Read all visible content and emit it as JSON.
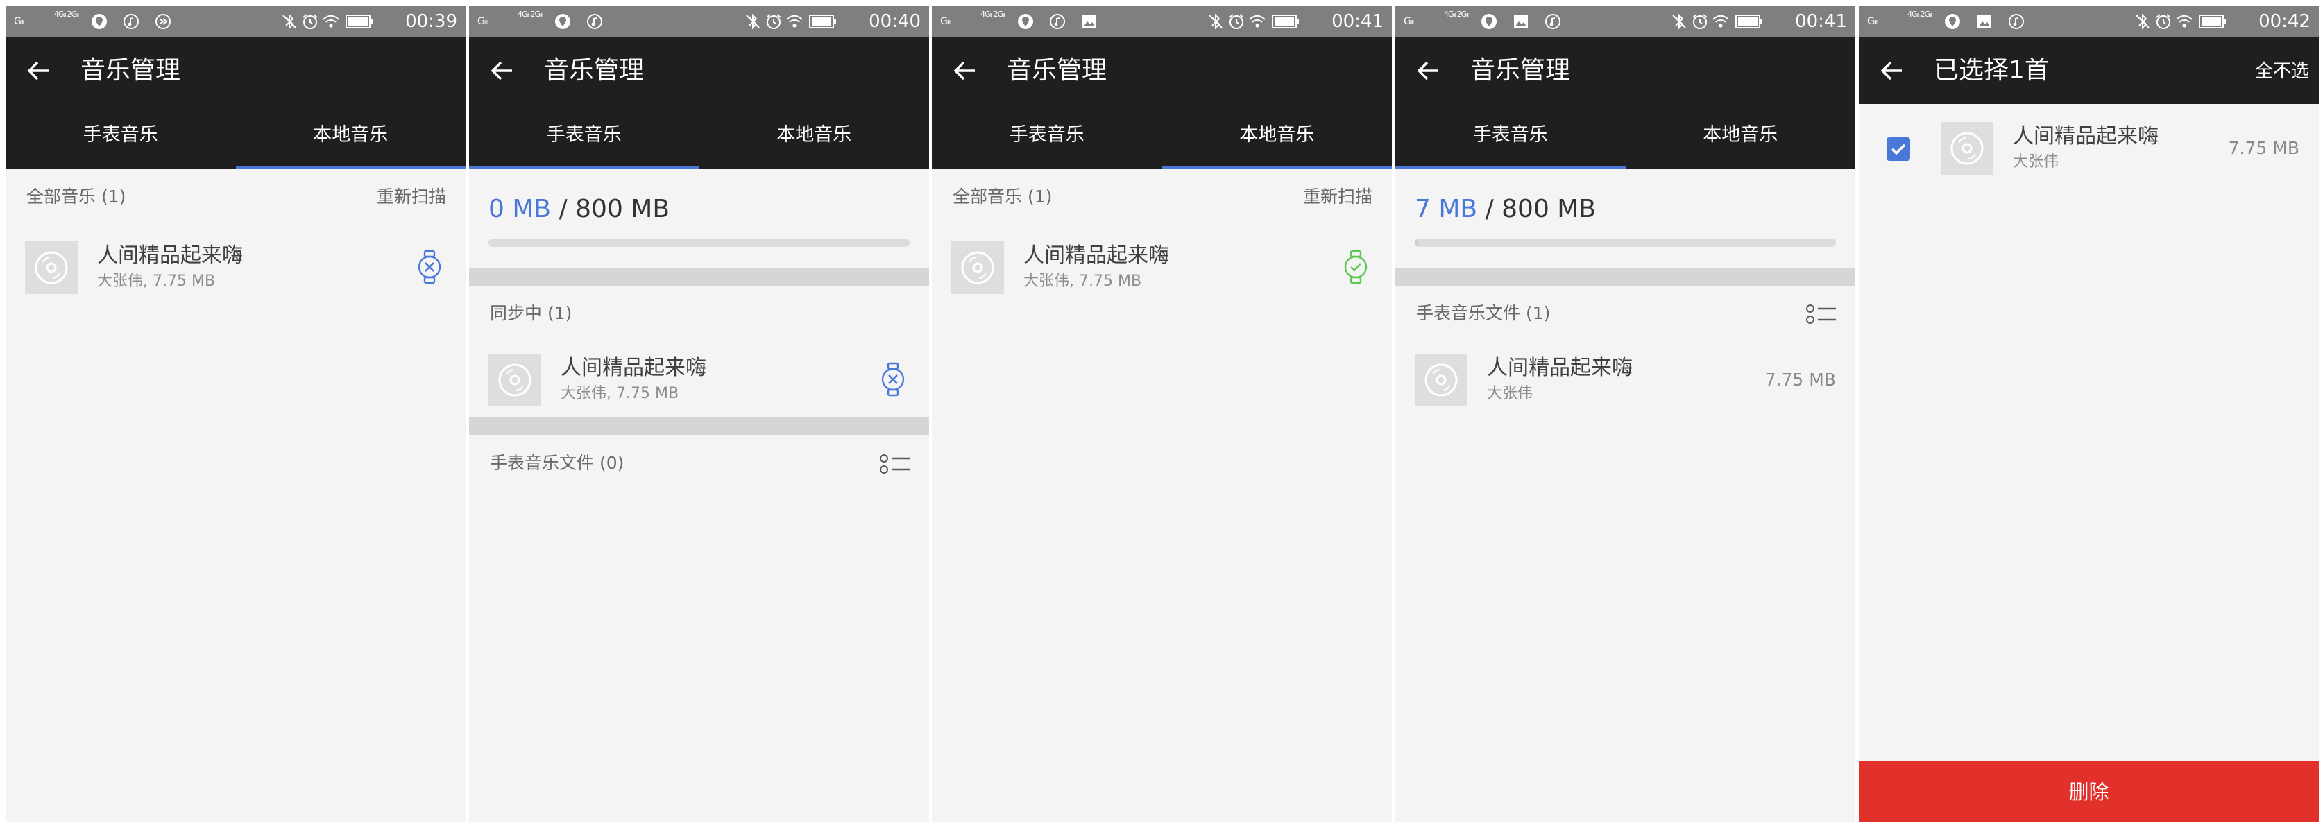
{
  "colors": {
    "status_bar": "#7f7f7f",
    "app_bar": "#1f1f1f",
    "accent_blue": "#4a78d8",
    "synced_green": "#5cc84e",
    "background": "#f4f4f4",
    "delete_red": "#e2312b"
  },
  "screens": [
    {
      "id": "s1",
      "status": {
        "signal_1": "Gᵢₗₗ",
        "signal_2": "4Gᵢₗₗ 2Gᵢₗₗ",
        "icons": [
          "location-icon",
          "music-note-icon",
          "fast-forward-icon"
        ],
        "time": "00:39"
      },
      "app_bar": {
        "title": "音乐管理",
        "mode": "back"
      },
      "tabs": [
        {
          "label": "手表音乐"
        },
        {
          "label": "本地音乐"
        }
      ],
      "active_tab": 1,
      "content": {
        "kind": "local",
        "section_title": "全部音乐 (1)",
        "section_action": "重新扫描",
        "songs": [
          {
            "title": "人间精品起来嗨",
            "subtitle": "大张伟, 7.75 MB",
            "state": "cancel-sync"
          }
        ]
      }
    },
    {
      "id": "s2",
      "status": {
        "signal_1": "Gᵢₗₗ",
        "signal_2": "4Gᵢₗₗ 2Gᵢₗₗ",
        "icons": [
          "location-icon",
          "music-note-icon"
        ],
        "time": "00:40"
      },
      "app_bar": {
        "title": "音乐管理",
        "mode": "back"
      },
      "tabs": [
        {
          "label": "手表音乐"
        },
        {
          "label": "本地音乐"
        }
      ],
      "active_tab": 0,
      "content": {
        "kind": "watch",
        "storage": {
          "used": "0 MB",
          "total": "/ 800 MB",
          "fraction": 0.0
        },
        "syncing_title": "同步中 (1)",
        "syncing_songs": [
          {
            "title": "人间精品起来嗨",
            "subtitle": "大张伟, 7.75 MB",
            "state": "cancel-sync"
          }
        ],
        "watch_title": "手表音乐文件 (0)",
        "watch_songs": []
      }
    },
    {
      "id": "s3",
      "status": {
        "signal_1": "Gᵢₗₗ",
        "signal_2": "4Gᵢₗₗ 2Gᵢₗₗ",
        "icons": [
          "location-icon",
          "music-note-icon",
          "image-icon"
        ],
        "time": "00:41"
      },
      "app_bar": {
        "title": "音乐管理",
        "mode": "back"
      },
      "tabs": [
        {
          "label": "手表音乐"
        },
        {
          "label": "本地音乐"
        }
      ],
      "active_tab": 1,
      "content": {
        "kind": "local",
        "section_title": "全部音乐 (1)",
        "section_action": "重新扫描",
        "songs": [
          {
            "title": "人间精品起来嗨",
            "subtitle": "大张伟, 7.75 MB",
            "state": "synced"
          }
        ]
      }
    },
    {
      "id": "s4",
      "status": {
        "signal_1": "Gᵢₗₗ",
        "signal_2": "4Gᵢₗₗ 2Gᵢₗₗ",
        "icons": [
          "location-icon",
          "image-icon",
          "music-note-icon"
        ],
        "time": "00:41"
      },
      "app_bar": {
        "title": "音乐管理",
        "mode": "back"
      },
      "tabs": [
        {
          "label": "手表音乐"
        },
        {
          "label": "本地音乐"
        }
      ],
      "active_tab": 0,
      "content": {
        "kind": "watch",
        "storage": {
          "used": "7 MB",
          "total": "/ 800 MB",
          "fraction": 0.00875
        },
        "syncing_title": "",
        "syncing_songs": [],
        "watch_title": "手表音乐文件 (1)",
        "watch_songs": [
          {
            "title": "人间精品起来嗨",
            "subtitle": "大张伟",
            "size": "7.75 MB"
          }
        ]
      }
    },
    {
      "id": "s5",
      "status": {
        "signal_1": "Gᵢₗₗ",
        "signal_2": "4Gᵢₗₗ 2Gᵢₗₗ",
        "icons": [
          "location-icon",
          "image-icon",
          "music-note-icon"
        ],
        "time": "00:42"
      },
      "app_bar": {
        "title": "已选择1首",
        "mode": "select",
        "action": "全不选"
      },
      "tabs": [],
      "active_tab": -1,
      "content": {
        "kind": "select",
        "songs": [
          {
            "title": "人间精品起来嗨",
            "subtitle": "大张伟",
            "size": "7.75 MB",
            "checked": true
          }
        ],
        "delete_label": "删除"
      }
    }
  ]
}
